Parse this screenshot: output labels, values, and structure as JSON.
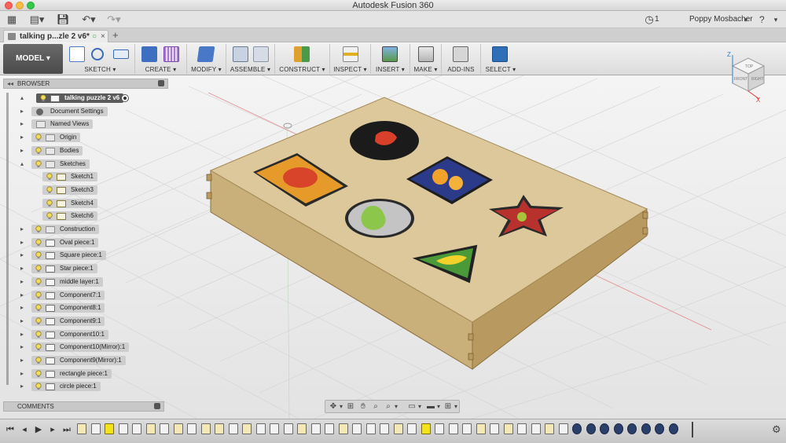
{
  "window": {
    "title": "Autodesk Fusion 360"
  },
  "appbar": {
    "job_count": "1",
    "user": "Poppy Mosbacher",
    "help": "?"
  },
  "tab": {
    "label": "talking p...zle 2 v6*",
    "sync": "○",
    "close": "×",
    "new": "+"
  },
  "toolbar": {
    "workspace": "MODEL ▾",
    "groups": [
      {
        "label": "SKETCH ▾"
      },
      {
        "label": "CREATE ▾"
      },
      {
        "label": "MODIFY ▾"
      },
      {
        "label": "ASSEMBLE ▾"
      },
      {
        "label": "CONSTRUCT ▾"
      },
      {
        "label": "INSPECT ▾"
      },
      {
        "label": "INSERT ▾"
      },
      {
        "label": "MAKE ▾"
      },
      {
        "label": "ADD-INS"
      },
      {
        "label": "SELECT ▾"
      }
    ]
  },
  "browser": {
    "title": "BROWSER",
    "items": [
      {
        "label": "talking puzzle 2 v6"
      },
      {
        "label": "Document Settings"
      },
      {
        "label": "Named Views"
      },
      {
        "label": "Origin"
      },
      {
        "label": "Bodies"
      },
      {
        "label": "Sketches"
      },
      {
        "label": "Sketch1"
      },
      {
        "label": "Sketch3"
      },
      {
        "label": "Sketch4"
      },
      {
        "label": "Sketch6"
      },
      {
        "label": "Construction"
      },
      {
        "label": "Oval piece:1"
      },
      {
        "label": "Square piece:1"
      },
      {
        "label": "Star piece:1"
      },
      {
        "label": "middle layer:1"
      },
      {
        "label": "Component7:1"
      },
      {
        "label": "Component8:1"
      },
      {
        "label": "Component9:1"
      },
      {
        "label": "Component10:1"
      },
      {
        "label": "Component10(Mirror):1"
      },
      {
        "label": "Component9(Mirror):1"
      },
      {
        "label": "rectangle piece:1"
      },
      {
        "label": "circle piece:1"
      }
    ]
  },
  "comments": {
    "title": "COMMENTS"
  },
  "viewcube": {
    "top": "TOP",
    "front": "FRONT",
    "right": "RIGHT",
    "axis_z": "Z",
    "axis_x": "X"
  },
  "colors": {
    "wood": "#dcc89a",
    "wood_side": "#c9b07a",
    "accent_orange": "#e69a2a",
    "accent_blue": "#2c3a8a",
    "star_red": "#b7322c"
  }
}
